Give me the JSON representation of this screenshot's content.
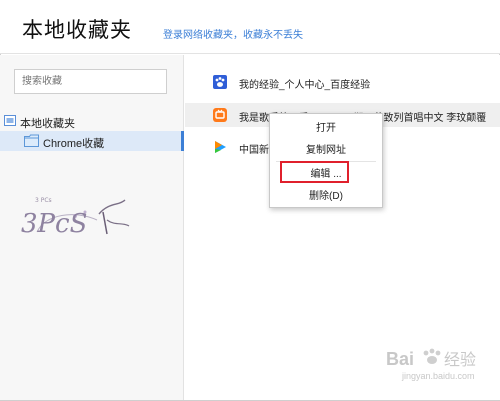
{
  "header": {
    "title": "本地收藏夹",
    "login_link": "登录网络收藏夹，收藏永不丢失"
  },
  "sidebar": {
    "search_placeholder": "搜索收藏",
    "root_label": "本地收藏夹",
    "child_label": "Chrome收藏",
    "logo_small_text": "3 PCs",
    "logo_text": "3PcS"
  },
  "bookmarks": [
    {
      "label": "我的经验_个人中心_百度经验",
      "icon": "baidu-paw-icon"
    },
    {
      "label": "我是歌手第四季20160122期：黄致列首唱中文 李玟颠覆",
      "icon": "mango-tv-icon"
    },
    {
      "label": "中国新",
      "icon": "tencent-video-icon"
    }
  ],
  "context_menu": {
    "open": "打开",
    "copy_url": "复制网址",
    "edit": "编辑 ...",
    "delete": "删除(D)"
  },
  "watermark": {
    "brand": "Bai",
    "brand_suffix": "经验",
    "url": "jingyan.baidu.com"
  },
  "colors": {
    "accent": "#3c7fd6",
    "highlight": "#e0202c",
    "selected_bg": "#dde9f8"
  }
}
